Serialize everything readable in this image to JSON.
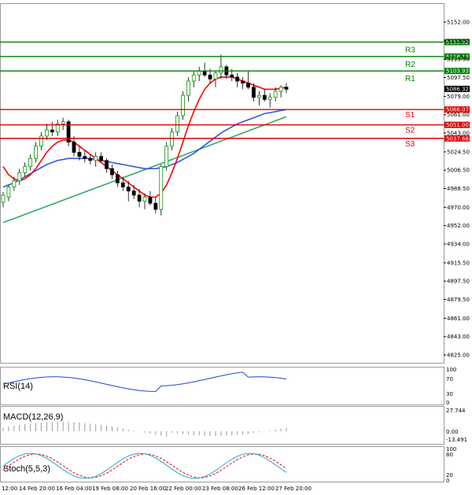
{
  "price_axis": {
    "ticks": [
      "5152.00",
      "5133.50",
      "5115.50",
      "5097.50",
      "5079.00",
      "5061.00",
      "5043.00",
      "5024.50",
      "5006.50",
      "4988.50",
      "4970.00",
      "4952.00",
      "4934.00",
      "4915.50",
      "4897.50",
      "4879.50",
      "4861.00",
      "4843.00",
      "4825.00"
    ],
    "min": 4825.0,
    "max": 5152.0
  },
  "levels": [
    {
      "name": "R3",
      "value": "5132.32",
      "kind": "resistance",
      "color": "#008000"
    },
    {
      "name": "R2",
      "value": "5118.13",
      "kind": "resistance",
      "color": "#008000"
    },
    {
      "name": "R1",
      "value": "5103.93",
      "kind": "resistance",
      "color": "#008000"
    },
    {
      "name": "S1",
      "value": "5066.07",
      "kind": "support",
      "color": "#e00000"
    },
    {
      "name": "S2",
      "value": "5051.00",
      "kind": "support",
      "color": "#e00000"
    },
    {
      "name": "S3",
      "value": "5037.68",
      "kind": "support",
      "color": "#e00000"
    }
  ],
  "current_price": {
    "value": "5086.32",
    "color": "#000000"
  },
  "time_axis": [
    "12:00",
    "14 Feb 20:00",
    "16 Feb 04:00",
    "19 Feb 08:00",
    "20 Feb 16:00",
    "22 Feb 00:00",
    "23 Feb 08:00",
    "26 Feb 12:00",
    "27 Feb 20:00"
  ],
  "indicators": {
    "rsi": {
      "name": "RSI(14)",
      "ticks": [
        "100",
        "70",
        "30",
        "0"
      ]
    },
    "macd": {
      "name": "MACD(12,26,9)",
      "ticks": [
        "27.744",
        "0.00",
        "-13.491"
      ]
    },
    "stoch": {
      "name": "Stoch(5,5,3)",
      "ticks": [
        "100",
        "80",
        "20",
        "0"
      ]
    }
  },
  "colors": {
    "bull": "#009900",
    "bear": "#cc0000",
    "ma_fast": "#ff0000",
    "ma_mid": "#3355dd",
    "ma_slow": "#33aa66",
    "grid": "#c8c8c8"
  },
  "chart_data": {
    "type": "candlestick",
    "series": [
      {
        "name": "candles",
        "ohlc": [
          [
            4975,
            4985,
            4970,
            4982
          ],
          [
            4980,
            4992,
            4976,
            4990
          ],
          [
            4990,
            5000,
            4986,
            4996
          ],
          [
            4996,
            5008,
            4992,
            5004
          ],
          [
            5004,
            5014,
            5000,
            5010
          ],
          [
            5010,
            5022,
            5006,
            5018
          ],
          [
            5018,
            5034,
            5014,
            5030
          ],
          [
            5030,
            5044,
            5026,
            5040
          ],
          [
            5040,
            5052,
            5036,
            5046
          ],
          [
            5046,
            5054,
            5040,
            5044
          ],
          [
            5044,
            5056,
            5040,
            5052
          ],
          [
            5052,
            5058,
            5046,
            5054
          ],
          [
            5054,
            5056,
            5030,
            5034
          ],
          [
            5034,
            5040,
            5020,
            5024
          ],
          [
            5024,
            5030,
            5016,
            5020
          ],
          [
            5020,
            5026,
            5014,
            5018
          ],
          [
            5018,
            5022,
            5012,
            5016
          ],
          [
            5016,
            5024,
            5010,
            5020
          ],
          [
            5020,
            5024,
            5014,
            5016
          ],
          [
            5016,
            5018,
            5004,
            5008
          ],
          [
            5008,
            5012,
            4998,
            5002
          ],
          [
            5002,
            5006,
            4990,
            4994
          ],
          [
            4994,
            5000,
            4986,
            4990
          ],
          [
            4990,
            4996,
            4976,
            4986
          ],
          [
            4986,
            4992,
            4978,
            4982
          ],
          [
            4982,
            4988,
            4970,
            4976
          ],
          [
            4976,
            4984,
            4968,
            4980
          ],
          [
            4980,
            4986,
            4972,
            4974
          ],
          [
            4974,
            4980,
            4964,
            4968
          ],
          [
            4968,
            5012,
            4962,
            5010
          ],
          [
            5010,
            5034,
            5006,
            5030
          ],
          [
            5030,
            5048,
            5026,
            5044
          ],
          [
            5044,
            5064,
            5040,
            5060
          ],
          [
            5060,
            5084,
            5056,
            5080
          ],
          [
            5080,
            5098,
            5074,
            5094
          ],
          [
            5094,
            5104,
            5088,
            5100
          ],
          [
            5100,
            5108,
            5094,
            5104
          ],
          [
            5104,
            5112,
            5098,
            5100
          ],
          [
            5100,
            5106,
            5092,
            5096
          ],
          [
            5096,
            5104,
            5088,
            5102
          ],
          [
            5102,
            5120,
            5096,
            5108
          ],
          [
            5108,
            5110,
            5096,
            5100
          ],
          [
            5100,
            5106,
            5094,
            5098
          ],
          [
            5098,
            5102,
            5088,
            5094
          ],
          [
            5094,
            5098,
            5086,
            5092
          ],
          [
            5092,
            5104,
            5086,
            5088
          ],
          [
            5088,
            5092,
            5074,
            5078
          ],
          [
            5078,
            5084,
            5070,
            5080
          ],
          [
            5080,
            5086,
            5074,
            5076
          ],
          [
            5076,
            5082,
            5068,
            5078
          ],
          [
            5078,
            5088,
            5074,
            5084
          ],
          [
            5084,
            5090,
            5078,
            5088
          ],
          [
            5088,
            5092,
            5082,
            5086
          ]
        ]
      },
      {
        "name": "MA fast",
        "values": [
          5010,
          5002,
          4998,
          4996,
          4998,
          5002,
          5008,
          5016,
          5024,
          5030,
          5034,
          5036,
          5036,
          5034,
          5030,
          5026,
          5022,
          5018,
          5014,
          5010,
          5006,
          5002,
          4998,
          4994,
          4990,
          4986,
          4982,
          4980,
          4980,
          4984,
          4992,
          5004,
          5018,
          5034,
          5050,
          5064,
          5076,
          5086,
          5092,
          5096,
          5098,
          5098,
          5098,
          5096,
          5094,
          5092,
          5090,
          5088,
          5086,
          5086,
          5086,
          5087,
          5088
        ]
      },
      {
        "name": "MA mid",
        "values": [
          4990,
          4992,
          4994,
          4997,
          5000,
          5003,
          5006,
          5009,
          5012,
          5014,
          5016,
          5017,
          5018,
          5018,
          5018,
          5018,
          5018,
          5017,
          5016,
          5015,
          5014,
          5013,
          5012,
          5011,
          5010,
          5009,
          5008,
          5008,
          5008,
          5009,
          5010,
          5012,
          5014,
          5017,
          5020,
          5023,
          5027,
          5031,
          5035,
          5039,
          5043,
          5046,
          5049,
          5052,
          5054,
          5056,
          5058,
          5060,
          5062,
          5063,
          5064,
          5065,
          5066
        ]
      },
      {
        "name": "MA slow",
        "values": [
          4955,
          4957,
          4959,
          4961,
          4963,
          4965,
          4967,
          4969,
          4971,
          4973,
          4975,
          4977,
          4979,
          4981,
          4983,
          4985,
          4987,
          4989,
          4991,
          4993,
          4995,
          4997,
          4999,
          5001,
          5003,
          5005,
          5007,
          5009,
          5011,
          5013,
          5015,
          5017,
          5019,
          5021,
          5023,
          5025,
          5027,
          5029,
          5031,
          5033,
          5035,
          5037,
          5039,
          5041,
          5043,
          5045,
          5047,
          5049,
          5051,
          5053,
          5055,
          5057,
          5059
        ]
      }
    ]
  }
}
